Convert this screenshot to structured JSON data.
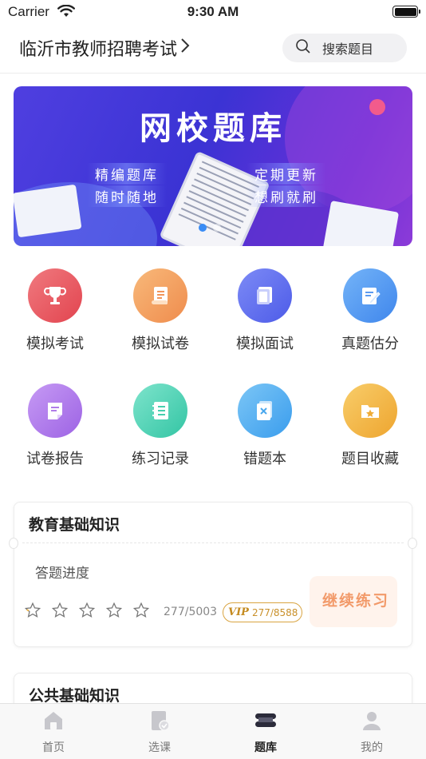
{
  "status_bar": {
    "carrier": "Carrier",
    "time": "9:30 AM"
  },
  "header": {
    "title": "临沂市教师招聘考试",
    "search_placeholder": "搜索题目"
  },
  "banner": {
    "title": "网校题库",
    "tags": [
      "精编题库",
      "随时随地",
      "定期更新",
      "想刷就刷"
    ],
    "active_index": 0,
    "total": 2
  },
  "grid_items": [
    {
      "label": "模拟考试",
      "icon": "trophy-icon",
      "color": "#ec5a63"
    },
    {
      "label": "模拟试卷",
      "icon": "scroll-icon",
      "color": "#f5a05e"
    },
    {
      "label": "模拟面试",
      "icon": "book-icon",
      "color": "#5a6cf0"
    },
    {
      "label": "真题估分",
      "icon": "edit-document-icon",
      "color": "#4a8ef0"
    },
    {
      "label": "试卷报告",
      "icon": "report-icon",
      "color": "#b078ea"
    },
    {
      "label": "练习记录",
      "icon": "notebook-icon",
      "color": "#46d3b4"
    },
    {
      "label": "错题本",
      "icon": "wrong-question-icon",
      "color": "#4aaef0"
    },
    {
      "label": "题目收藏",
      "icon": "folder-star-icon",
      "color": "#f2b03e"
    }
  ],
  "cards": [
    {
      "title": "教育基础知识",
      "subtitle": "答题进度",
      "stars_filled": 0,
      "stars_total": 5,
      "progress": "277/5003",
      "vip_label": "VIP",
      "vip_progress": "277/8588",
      "action": "继续练习"
    },
    {
      "title": "公共基础知识"
    }
  ],
  "tab_bar": {
    "active_index": 2,
    "tabs": [
      {
        "label": "首页",
        "icon": "home-icon"
      },
      {
        "label": "选课",
        "icon": "course-select-icon"
      },
      {
        "label": "题库",
        "icon": "question-bank-icon"
      },
      {
        "label": "我的",
        "icon": "profile-icon"
      }
    ]
  }
}
